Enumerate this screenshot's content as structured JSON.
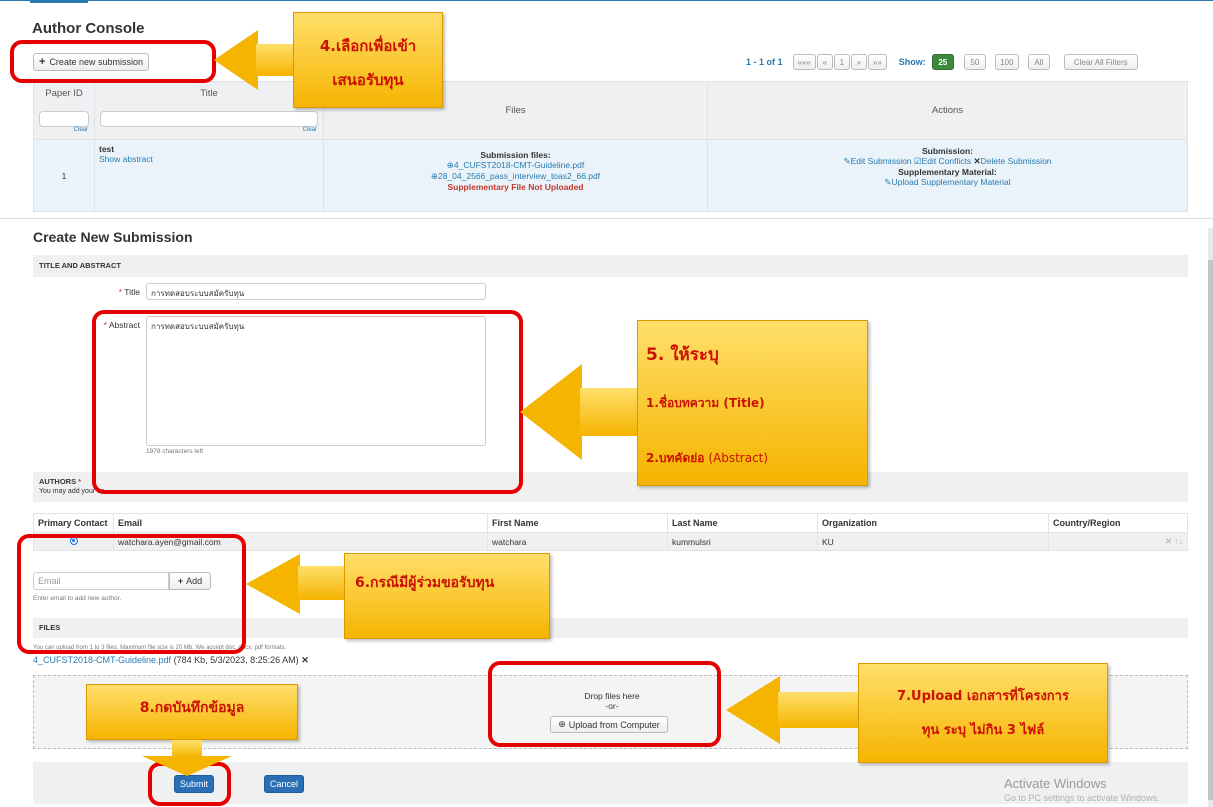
{
  "console": {
    "title": "Author Console",
    "create_label": "Create new submission",
    "range": "1 - 1 of 1",
    "pager": [
      "«««",
      "«",
      "1",
      "»",
      "»»"
    ],
    "show_label": "Show:",
    "page_sizes": [
      "25",
      "50",
      "100",
      "All"
    ],
    "clear_filters": "Clear All Filters"
  },
  "papers": {
    "headers": {
      "id": "Paper ID",
      "title": "Title",
      "files": "Files",
      "actions": "Actions"
    },
    "clear": "Clear",
    "row": {
      "id": "1",
      "title": "test",
      "show_abstract": "Show abstract",
      "files_heading": "Submission files:",
      "file1": "4_CUFST2018-CMT-Guideline.pdf",
      "file2": "28_04_2566_pass_interview_toas2_66.pdf",
      "supp_missing": "Supplementary File Not Uploaded",
      "submission_heading": "Submission:",
      "edit_submission": "Edit Submission",
      "edit_conflicts": "Edit Conflicts",
      "delete_submission": "Delete Submission",
      "supp_heading": "Supplementary Material:",
      "upload_supp": "Upload Supplementary Material"
    }
  },
  "form": {
    "heading": "Create New Submission",
    "section_title": "TITLE AND ABSTRACT",
    "title_label": "Title",
    "title_value": "การทดสอบระบบสมัครับทุน",
    "abstract_label": "Abstract",
    "abstract_value": "การทดสอบระบบสมัครับทุน",
    "chars_left": "1978 characters left",
    "authors_title": "AUTHORS",
    "authors_sub": "You may add your co",
    "authors_headers": [
      "Primary Contact",
      "Email",
      "First Name",
      "Last Name",
      "Organization",
      "Country/Region"
    ],
    "author": {
      "email": "watchara.ayen@gmail.com",
      "first": "watchara",
      "last": "kummulsri",
      "org": "KU",
      "country": ""
    },
    "email_placeholder": "Email",
    "add_label": "Add",
    "email_help": "Enter email to add new author.",
    "files_title": "FILES",
    "files_help": "You can upload from 1 to 3 files. Maximum file size is 20 Mb. We accept doc, docx, pdf formats.",
    "uploaded_file": "4_CUFST2018-CMT-Guideline.pdf",
    "uploaded_meta": "(784 Kb, 5/3/2023, 8:25:26 AM)",
    "drop_here": "Drop files here",
    "or": "-or-",
    "upload_computer": "Upload from Computer",
    "submit": "Submit",
    "cancel": "Cancel"
  },
  "callouts": {
    "c4_line1": "4.เลือกเพื่อเข้า",
    "c4_line2": "เสนอรับทุน",
    "c5_head": "5. ให้ระบุ",
    "c5_line1": "1.ชื่อบทความ (Title)",
    "c5_line2a": "2.บทคัดย่อ",
    "c5_line2b": " (Abstract)",
    "c6": "6.กรณีมีผู้ร่วมขอรับทุน",
    "c7_line1": "7.Upload เอกสารที่โครงการ",
    "c7_line2": "ทุน ระบุ ไม่กิน 3 ไฟล์",
    "c8": "8.กดบันทึกข้อมูล"
  },
  "windows": {
    "activate": "Activate Windows",
    "activate_sub": "Go to PC settings to activate Windows."
  },
  "colors": {
    "link": "#2a7ab0",
    "callout": "#f5b400",
    "highlight": "#e60000",
    "primary_button": "#2a6fb5"
  }
}
